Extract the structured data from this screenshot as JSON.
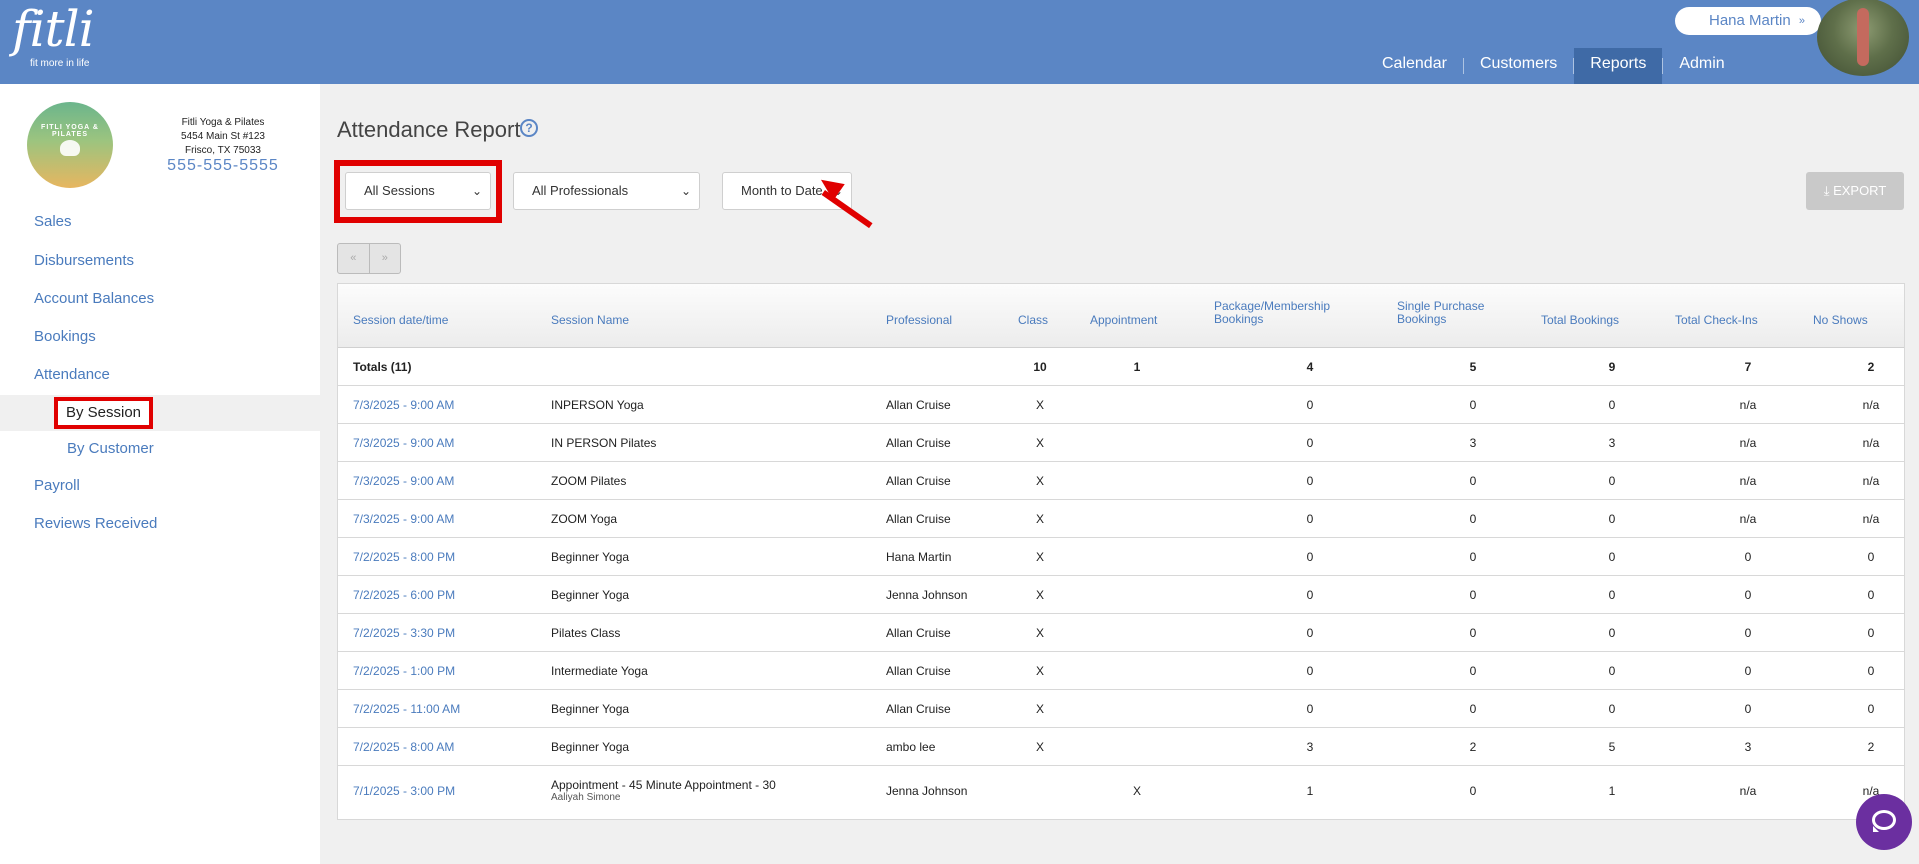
{
  "header": {
    "logo_word": "fitli",
    "logo_tagline": "fit more in life",
    "user_name": "Hana Martin",
    "user_chevron": "»",
    "nav": [
      {
        "label": "Calendar",
        "active": false
      },
      {
        "label": "Customers",
        "active": false
      },
      {
        "label": "Reports",
        "active": true
      },
      {
        "label": "Admin",
        "active": false
      }
    ]
  },
  "studio": {
    "logo_text": "FITLI YOGA & PILATES",
    "name": "Fitli Yoga & Pilates",
    "address1": "5454 Main St #123",
    "address2": "Frisco, TX 75033",
    "phone": "555-555-5555"
  },
  "sidebar": {
    "items": [
      "Sales",
      "Disbursements",
      "Account Balances",
      "Bookings",
      "Attendance",
      "Payroll",
      "Reviews Received"
    ],
    "attendance_sub": [
      "By Session",
      "By Customer"
    ],
    "active_sub": "By Session"
  },
  "page": {
    "title": "Attendance Report",
    "help_icon": "?",
    "filters": {
      "sessions": "All Sessions",
      "professionals": "All Professionals",
      "date_range": "Month to Date"
    },
    "export_label": "EXPORT",
    "pager_prev": "«",
    "pager_next": "»"
  },
  "table": {
    "headers": {
      "date": "Session date/time",
      "name": "Session Name",
      "professional": "Professional",
      "class": "Class",
      "appointment": "Appointment",
      "package": "Package/Membership Bookings",
      "single": "Single Purchase Bookings",
      "total_bookings": "Total Bookings",
      "checkins": "Total Check-Ins",
      "noshows": "No Shows"
    },
    "totals": {
      "label": "Totals (11)",
      "class": "10",
      "appointment": "1",
      "package": "4",
      "single": "5",
      "total_bookings": "9",
      "checkins": "7",
      "noshows": "2"
    },
    "rows": [
      {
        "date": "7/3/2025 - 9:00 AM",
        "name": "INPERSON Yoga",
        "sub": "",
        "professional": "Allan Cruise",
        "class": "X",
        "appointment": "",
        "package": "0",
        "single": "0",
        "total_bookings": "0",
        "checkins": "n/a",
        "noshows": "n/a"
      },
      {
        "date": "7/3/2025 - 9:00 AM",
        "name": "IN PERSON Pilates",
        "sub": "",
        "professional": "Allan Cruise",
        "class": "X",
        "appointment": "",
        "package": "0",
        "single": "3",
        "total_bookings": "3",
        "checkins": "n/a",
        "noshows": "n/a"
      },
      {
        "date": "7/3/2025 - 9:00 AM",
        "name": "ZOOM Pilates",
        "sub": "",
        "professional": "Allan Cruise",
        "class": "X",
        "appointment": "",
        "package": "0",
        "single": "0",
        "total_bookings": "0",
        "checkins": "n/a",
        "noshows": "n/a"
      },
      {
        "date": "7/3/2025 - 9:00 AM",
        "name": "ZOOM Yoga",
        "sub": "",
        "professional": "Allan Cruise",
        "class": "X",
        "appointment": "",
        "package": "0",
        "single": "0",
        "total_bookings": "0",
        "checkins": "n/a",
        "noshows": "n/a"
      },
      {
        "date": "7/2/2025 - 8:00 PM",
        "name": "Beginner Yoga",
        "sub": "",
        "professional": "Hana Martin",
        "class": "X",
        "appointment": "",
        "package": "0",
        "single": "0",
        "total_bookings": "0",
        "checkins": "0",
        "noshows": "0"
      },
      {
        "date": "7/2/2025 - 6:00 PM",
        "name": "Beginner Yoga",
        "sub": "",
        "professional": "Jenna Johnson",
        "class": "X",
        "appointment": "",
        "package": "0",
        "single": "0",
        "total_bookings": "0",
        "checkins": "0",
        "noshows": "0"
      },
      {
        "date": "7/2/2025 - 3:30 PM",
        "name": "Pilates Class",
        "sub": "",
        "professional": "Allan Cruise",
        "class": "X",
        "appointment": "",
        "package": "0",
        "single": "0",
        "total_bookings": "0",
        "checkins": "0",
        "noshows": "0"
      },
      {
        "date": "7/2/2025 - 1:00 PM",
        "name": "Intermediate Yoga",
        "sub": "",
        "professional": "Allan Cruise",
        "class": "X",
        "appointment": "",
        "package": "0",
        "single": "0",
        "total_bookings": "0",
        "checkins": "0",
        "noshows": "0"
      },
      {
        "date": "7/2/2025 - 11:00 AM",
        "name": "Beginner Yoga",
        "sub": "",
        "professional": "Allan Cruise",
        "class": "X",
        "appointment": "",
        "package": "0",
        "single": "0",
        "total_bookings": "0",
        "checkins": "0",
        "noshows": "0"
      },
      {
        "date": "7/2/2025 - 8:00 AM",
        "name": "Beginner Yoga",
        "sub": "",
        "professional": "ambo lee",
        "class": "X",
        "appointment": "",
        "package": "3",
        "single": "2",
        "total_bookings": "5",
        "checkins": "3",
        "noshows": "2"
      },
      {
        "date": "7/1/2025 - 3:00 PM",
        "name": "Appointment - 45 Minute Appointment - 30",
        "sub": "Aaliyah Simone",
        "professional": "Jenna Johnson",
        "class": "",
        "appointment": "X",
        "package": "1",
        "single": "0",
        "total_bookings": "1",
        "checkins": "n/a",
        "noshows": "n/a"
      }
    ]
  }
}
